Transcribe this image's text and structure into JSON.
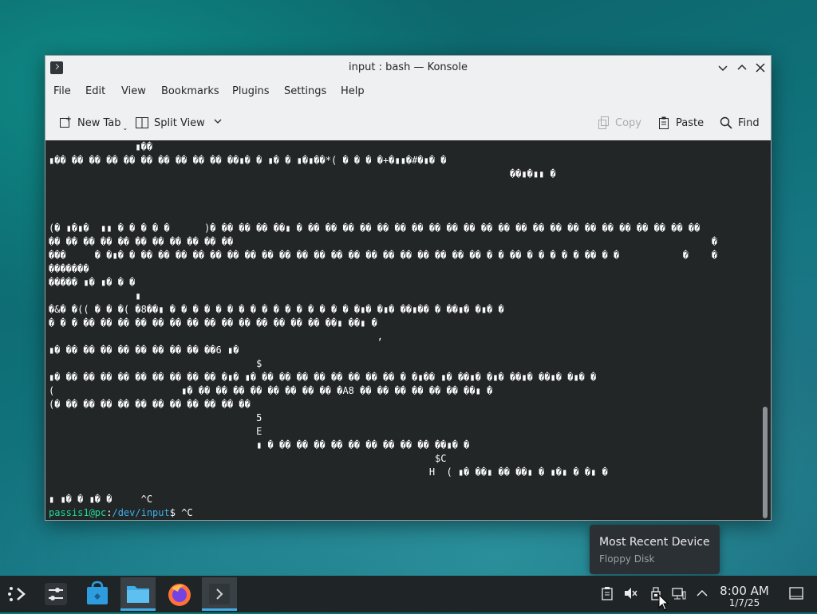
{
  "window": {
    "title": "input : bash — Konsole",
    "controls": [
      "minimize",
      "maximize",
      "close"
    ]
  },
  "menu": [
    "File",
    "Edit",
    "View",
    "Bookmarks",
    "Plugins",
    "Settings",
    "Help"
  ],
  "toolbar": {
    "new_tab": "New Tab",
    "split_view": "Split View",
    "copy": "Copy",
    "paste": "Paste",
    "find": "Find"
  },
  "terminal": {
    "garbage_lines": [
      "               ▮�� ",
      "▮�� �� �� �� �� �� �� �� �� �� ��▮� � ▮� � ▮�▮��*( � � � �+�▮▮�#�▮� �",
      "                                                                                ��▮�▮▮ �",
      "",
      "",
      "",
      "(� ▮�▮�  ▮▮ � � � � �      )� �� �� �� ��▮ � �� �� �� �� �� �� �� �� �� �� �� �� �� �� �� �� �� �� �� �� �� �� ��",
      "�� �� �� �� �� �� �� �� �� �� ��                                                                                   �",
      "���     � �▮� � �� �� �� �� �� �� �� �� �� �� �� �� �� �� �� �� �� �� �� �� � � �� � � � � � �� � �           �    �",
      "�������",
      "����� ▮� ▮� � �",
      "               ▮",
      "�&� �(( � � �( �8��▮ � � � � � � � � � � � � � � � � �▮� �▮� ��▮�� � ��▮� �▮� �",
      "� � � �� �� �� �� �� �� �� �� �� �� �� �� �� �� ��▮ ��▮ �",
      "                                                         ,",
      "▮� �� �� �� �� �� �� �� �� ��6 ▮�",
      "                                    $",
      "▮� �� �� �� �� �� �� �� �� �� �▮� ▮� �� �� �� �� �� �� �� �� � �▮�� ▮� ��▮� �▮� ��▮� ��▮� �▮� �",
      "(                      ▮� �� �� �� �� �� �� �� �� �A8 �� �� �� �� �� �� ��▮ �",
      "(� �� �� �� �� �� �� �� �� �� �� ��",
      "                                    5",
      "                                    E",
      "                                    ▮ � �� �� �� �� �� �� �� �� �� ��▮� �",
      "                                                                   $C",
      "                                                                  H  ( ▮� ��▮ �� ��▮ � ▮�▮ � �▮ �",
      "",
      "▮ ▮� � ▮� �     ^C"
    ],
    "prompt_user": "passis1@pc",
    "prompt_sep": ":",
    "prompt_path": "/dev/input",
    "prompt_end": "$ ",
    "line1_cmd": "^C"
  },
  "tooltip": {
    "title": "Most Recent Device",
    "subtitle": "Floppy Disk"
  },
  "taskbar": {
    "apps": [
      "application-launcher-icon",
      "system-settings-icon",
      "discover-store-icon",
      "file-manager-icon",
      "firefox-icon",
      "konsole-icon"
    ],
    "clock_time": "8:00 AM",
    "clock_date": "1/7/25"
  },
  "colors": {
    "terminal_bg": "#232627",
    "prompt_user": "#1cdc9a",
    "prompt_path": "#3daee9",
    "accent": "#3daee9"
  }
}
